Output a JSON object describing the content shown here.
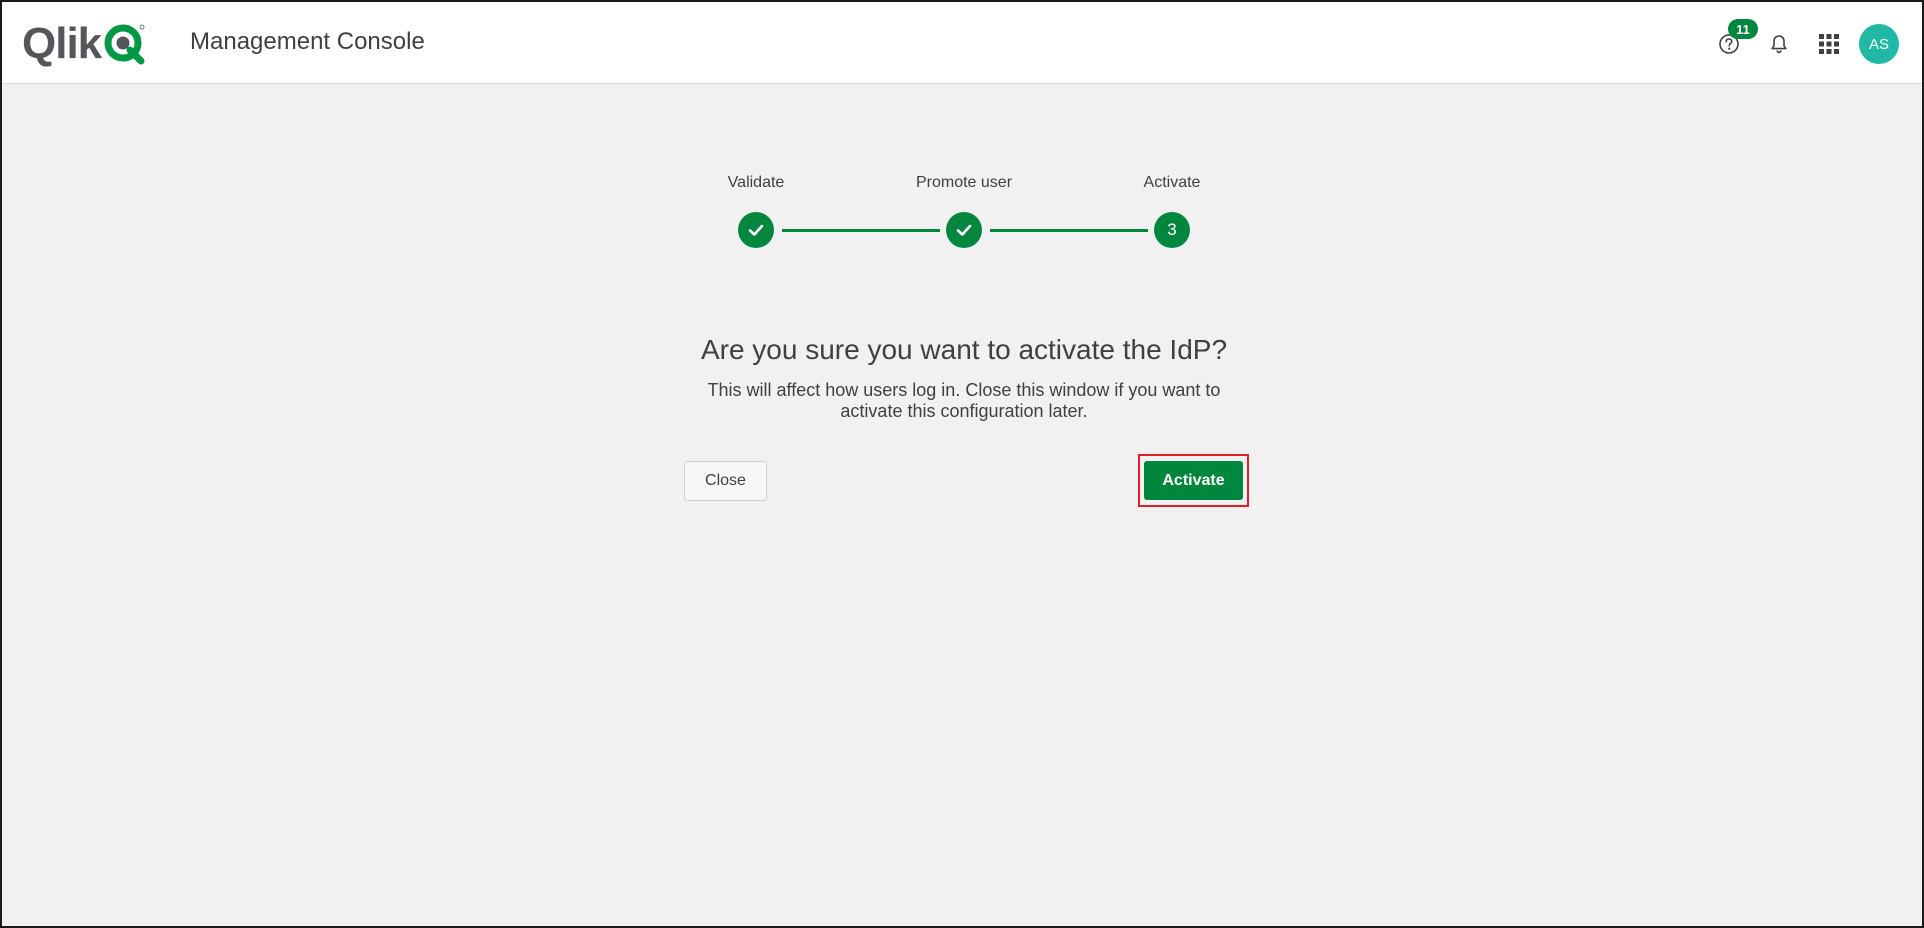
{
  "header": {
    "logo_text": "Qlik",
    "app_title": "Management Console",
    "help_badge": "11",
    "avatar_initials": "AS",
    "icons": [
      "help-icon",
      "bell-icon",
      "apps-grid-icon"
    ]
  },
  "stepper": {
    "steps": [
      {
        "label": "Validate",
        "state": "done"
      },
      {
        "label": "Promote user",
        "state": "done"
      },
      {
        "label": "Activate",
        "state": "current",
        "number": "3"
      }
    ]
  },
  "dialog": {
    "question": "Are you sure you want to activate the IdP?",
    "description_line1": "This will affect how users log in. Close this window if you want to",
    "description_line2": "activate this configuration later.",
    "close_label": "Close",
    "activate_label": "Activate"
  },
  "colors": {
    "accent": "#00873d",
    "avatar": "#21b9a5",
    "highlight": "#e01f2a"
  }
}
